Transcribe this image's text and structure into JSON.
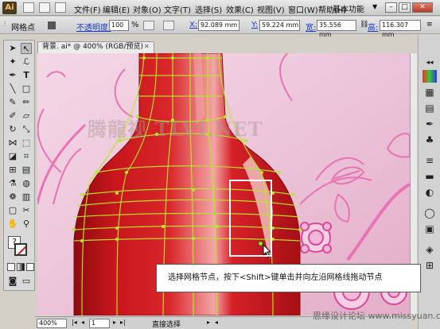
{
  "app": {
    "logo": "Ai",
    "workspace": "基本功能"
  },
  "menu": {
    "items": [
      {
        "label": "文件(F)"
      },
      {
        "label": "编辑(E)"
      },
      {
        "label": "对象(O)"
      },
      {
        "label": "文字(T)"
      },
      {
        "label": "选择(S)"
      },
      {
        "label": "效果(C)"
      },
      {
        "label": "视图(V)"
      },
      {
        "label": "窗口(W)"
      },
      {
        "label": "帮助(H)"
      }
    ]
  },
  "control_bar": {
    "tool_name": "网格点",
    "opacity_label": "不透明度:",
    "opacity_value": "100",
    "opacity_unit": "%",
    "x_label": "X:",
    "x_value": "92.089 mm",
    "y_label": "Y:",
    "y_value": "59.224 mm",
    "w_label": "宽:",
    "w_value": "35.556 mm",
    "h_label": "高:",
    "h_value": "116.307 mm"
  },
  "document": {
    "tab_title": "背景. ai* @ 400% (RGB/预览)"
  },
  "status_bar": {
    "zoom": "400%",
    "page": "1",
    "status_text": "直接选择"
  },
  "instruction": "选择网格节点，按下<Shift>键单击并向左沿网格线拖动节点",
  "watermarks": {
    "top": "腾龍视  TLVI.NET",
    "bottom": "思缘设计论坛  www.missyuan.com"
  },
  "colors": {
    "bottle_red": "#c8161c",
    "mesh_line": "#b7e62f",
    "background_pink": "#eac3da",
    "flower_pink": "#e874b7",
    "selection_box": "#ffffff"
  }
}
